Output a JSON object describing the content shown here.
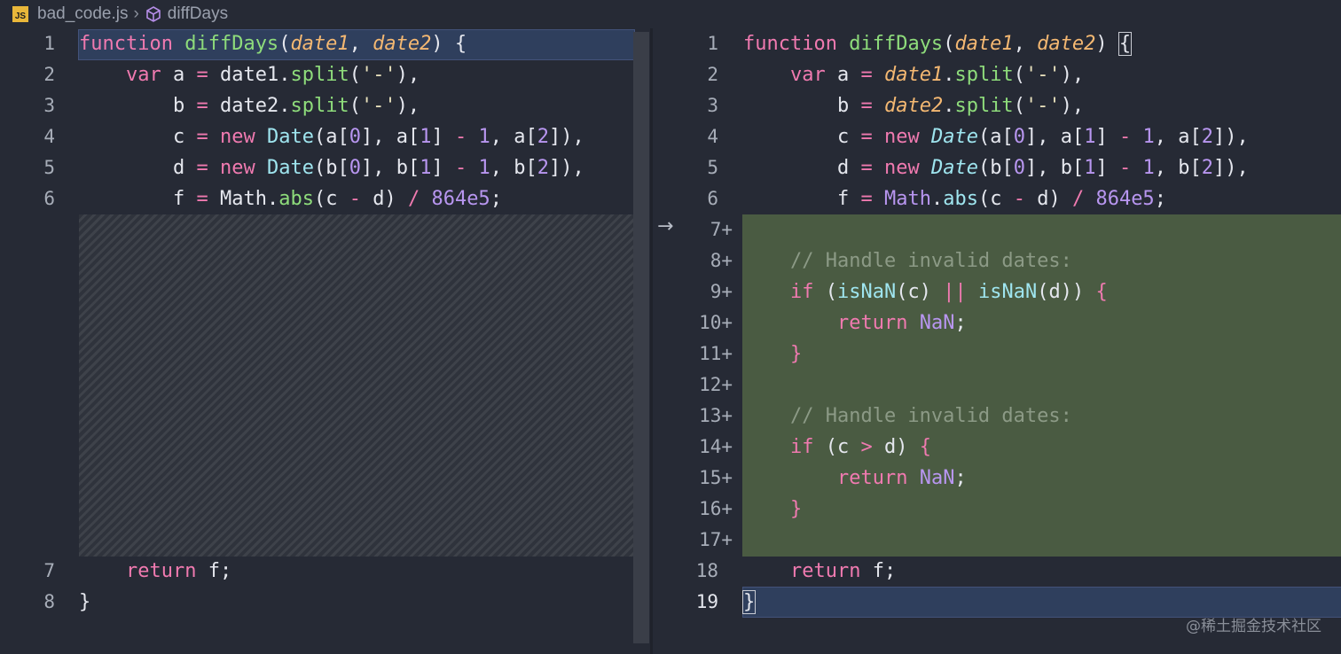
{
  "breadcrumb": {
    "file": "bad_code.js",
    "symbol": "diffDays",
    "file_icon_text": "JS"
  },
  "left_line_numbers": [
    "1",
    "2",
    "3",
    "4",
    "5",
    "6",
    "7",
    "8"
  ],
  "right_line_numbers": [
    "1",
    "2",
    "3",
    "4",
    "5",
    "6",
    "7+",
    "8+",
    "9+",
    "10+",
    "11+",
    "12+",
    "13+",
    "14+",
    "15+",
    "16+",
    "17+",
    "18",
    "19"
  ],
  "code": {
    "l1_kw": "function",
    "l1_fn": "diffDays",
    "l1_p1": "date1",
    "l1_p2": "date2",
    "l2_kw": "var",
    "l2_a": "a",
    "l2_obj": "date1",
    "l2_split": "split",
    "l2_str": "'-'",
    "l3_b": "b",
    "l3_obj": "date2",
    "l3_split": "split",
    "l3_str": "'-'",
    "l4_c": "c",
    "l4_new": "new",
    "l4_date": "Date",
    "l4_a": "a",
    "l4_n0": "0",
    "l4_n1": "1",
    "l4_one": "1",
    "l4_n2": "2",
    "l5_d": "d",
    "l5_new": "new",
    "l5_date": "Date",
    "l5_b": "b",
    "l5_n0": "0",
    "l5_n1": "1",
    "l5_one": "1",
    "l5_n2": "2",
    "l6_f": "f",
    "l6_math": "Math",
    "l6_abs": "abs",
    "l6_num": "864e5",
    "comment1": "// Handle invalid dates:",
    "if1_kw": "if",
    "isnan": "isNaN",
    "return_kw": "return",
    "nan": "NaN",
    "comment2": "// Handle invalid dates:",
    "if2_kw": "if",
    "ret_f": "f"
  },
  "watermark": "@稀土掘金技术社区"
}
